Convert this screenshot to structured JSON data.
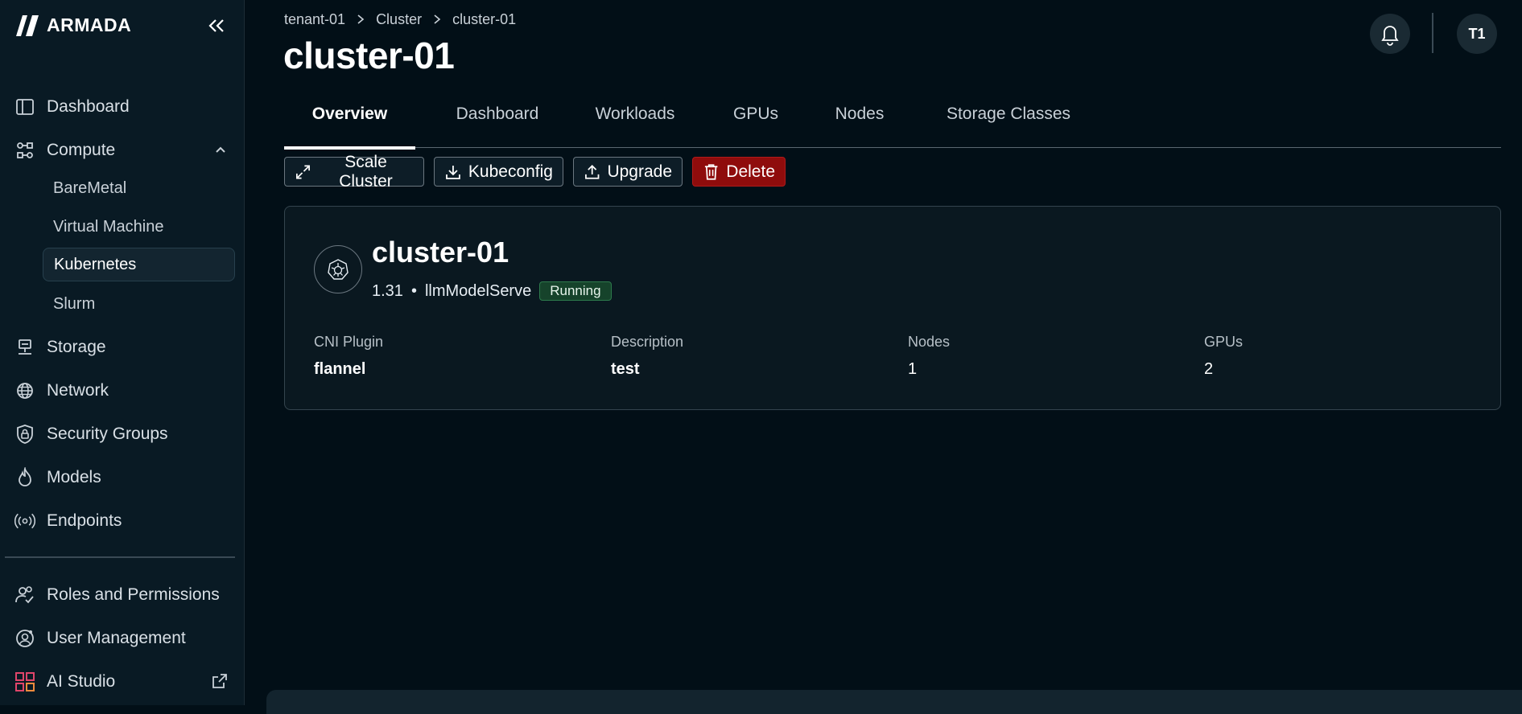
{
  "sidebar": {
    "brand": "ARMADA",
    "items": [
      {
        "label": "Dashboard",
        "icon": "panel-icon"
      },
      {
        "label": "Compute",
        "icon": "compute-icon"
      },
      {
        "label": "Storage",
        "icon": "storage-icon"
      },
      {
        "label": "Network",
        "icon": "globe-icon"
      },
      {
        "label": "Security Groups",
        "icon": "lock-icon"
      },
      {
        "label": "Models",
        "icon": "flame-icon"
      },
      {
        "label": "Endpoints",
        "icon": "broadcast-icon"
      },
      {
        "label": "Roles and Permissions",
        "icon": "users-icon"
      },
      {
        "label": "User Management",
        "icon": "user-settings-icon"
      },
      {
        "label": "AI Studio",
        "icon": "grid-icon"
      }
    ],
    "compute_sub": [
      {
        "label": "BareMetal"
      },
      {
        "label": "Virtual Machine"
      },
      {
        "label": "Kubernetes",
        "active": true
      },
      {
        "label": "Slurm"
      }
    ]
  },
  "header": {
    "breadcrumb": [
      "tenant-01",
      "Cluster",
      "cluster-01"
    ],
    "title": "cluster-01",
    "avatar_initials": "T1"
  },
  "tabs": [
    "Overview",
    "Dashboard",
    "Workloads",
    "GPUs",
    "Nodes",
    "Storage Classes"
  ],
  "active_tab": "Overview",
  "actions": {
    "scale": "Scale Cluster",
    "kubeconfig": "Kubeconfig",
    "upgrade": "Upgrade",
    "delete": "Delete"
  },
  "cluster": {
    "name": "cluster-01",
    "version": "1.31",
    "separator": "•",
    "template": "llmModelServe",
    "status": "Running",
    "fields": [
      {
        "label": "CNI Plugin",
        "value": "flannel"
      },
      {
        "label": "Description",
        "value": "test"
      },
      {
        "label": "Nodes",
        "value": "1"
      },
      {
        "label": "GPUs",
        "value": "2"
      }
    ]
  },
  "colors": {
    "background": "#020f17",
    "sidebar": "#091a24",
    "danger": "#8f0c0c",
    "success_badge": "#16432b"
  }
}
